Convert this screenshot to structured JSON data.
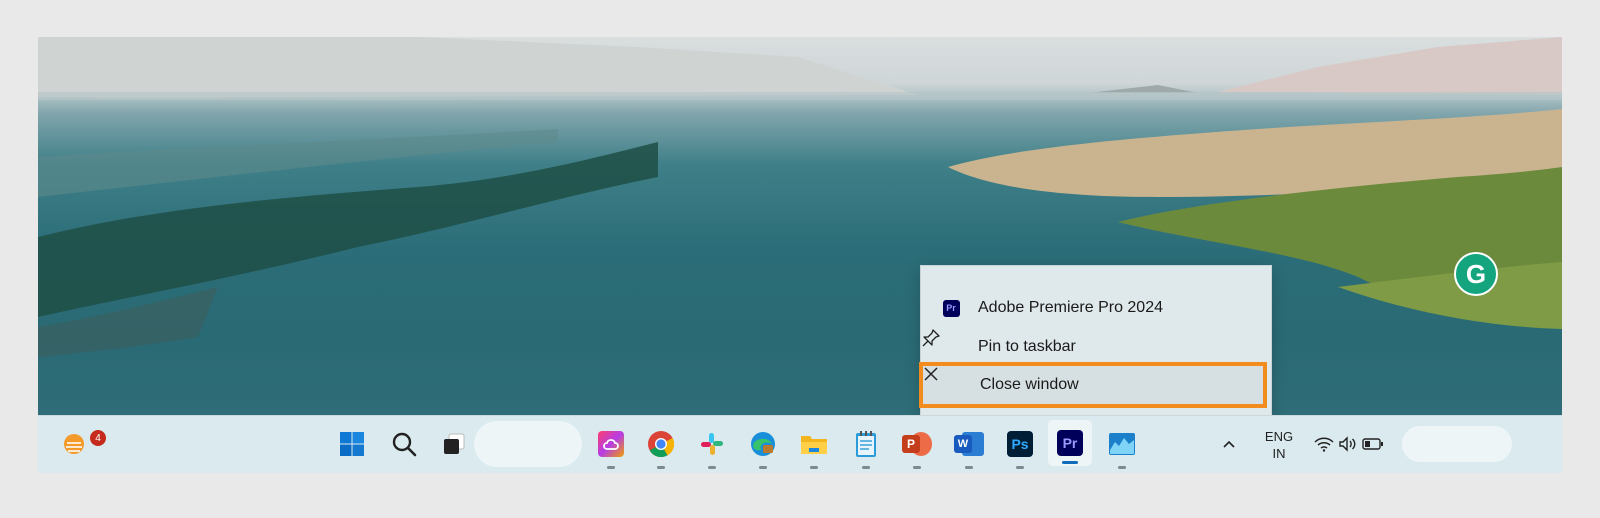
{
  "context_menu": {
    "app_name": "Adobe Premiere Pro 2024",
    "pin_label": "Pin to taskbar",
    "close_label": "Close window",
    "highlight_color": "#f28c1e"
  },
  "taskbar": {
    "weather_badge": "4",
    "app_icon_text": {
      "photoshop": "Ps",
      "premiere": "Pr",
      "word": "W",
      "powerpoint": "P",
      "premiere_small": "Pr"
    },
    "language_line1": "ENG",
    "language_line2": "IN"
  },
  "grammarly_letter": "G"
}
